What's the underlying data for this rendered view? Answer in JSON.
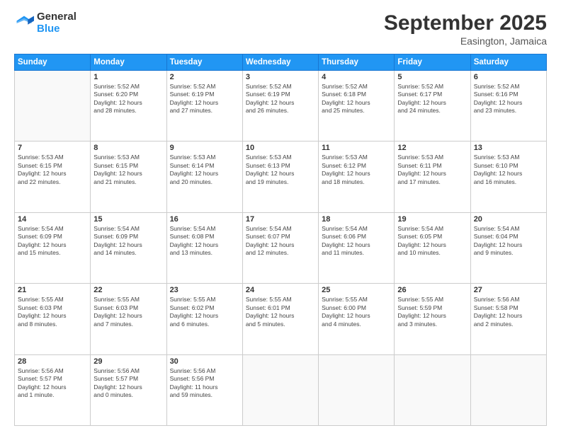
{
  "logo": {
    "general": "General",
    "blue": "Blue"
  },
  "header": {
    "month": "September 2025",
    "location": "Easington, Jamaica"
  },
  "weekdays": [
    "Sunday",
    "Monday",
    "Tuesday",
    "Wednesday",
    "Thursday",
    "Friday",
    "Saturday"
  ],
  "weeks": [
    [
      {
        "day": "",
        "info": ""
      },
      {
        "day": "1",
        "info": "Sunrise: 5:52 AM\nSunset: 6:20 PM\nDaylight: 12 hours\nand 28 minutes."
      },
      {
        "day": "2",
        "info": "Sunrise: 5:52 AM\nSunset: 6:19 PM\nDaylight: 12 hours\nand 27 minutes."
      },
      {
        "day": "3",
        "info": "Sunrise: 5:52 AM\nSunset: 6:19 PM\nDaylight: 12 hours\nand 26 minutes."
      },
      {
        "day": "4",
        "info": "Sunrise: 5:52 AM\nSunset: 6:18 PM\nDaylight: 12 hours\nand 25 minutes."
      },
      {
        "day": "5",
        "info": "Sunrise: 5:52 AM\nSunset: 6:17 PM\nDaylight: 12 hours\nand 24 minutes."
      },
      {
        "day": "6",
        "info": "Sunrise: 5:52 AM\nSunset: 6:16 PM\nDaylight: 12 hours\nand 23 minutes."
      }
    ],
    [
      {
        "day": "7",
        "info": "Sunrise: 5:53 AM\nSunset: 6:15 PM\nDaylight: 12 hours\nand 22 minutes."
      },
      {
        "day": "8",
        "info": "Sunrise: 5:53 AM\nSunset: 6:15 PM\nDaylight: 12 hours\nand 21 minutes."
      },
      {
        "day": "9",
        "info": "Sunrise: 5:53 AM\nSunset: 6:14 PM\nDaylight: 12 hours\nand 20 minutes."
      },
      {
        "day": "10",
        "info": "Sunrise: 5:53 AM\nSunset: 6:13 PM\nDaylight: 12 hours\nand 19 minutes."
      },
      {
        "day": "11",
        "info": "Sunrise: 5:53 AM\nSunset: 6:12 PM\nDaylight: 12 hours\nand 18 minutes."
      },
      {
        "day": "12",
        "info": "Sunrise: 5:53 AM\nSunset: 6:11 PM\nDaylight: 12 hours\nand 17 minutes."
      },
      {
        "day": "13",
        "info": "Sunrise: 5:53 AM\nSunset: 6:10 PM\nDaylight: 12 hours\nand 16 minutes."
      }
    ],
    [
      {
        "day": "14",
        "info": "Sunrise: 5:54 AM\nSunset: 6:09 PM\nDaylight: 12 hours\nand 15 minutes."
      },
      {
        "day": "15",
        "info": "Sunrise: 5:54 AM\nSunset: 6:09 PM\nDaylight: 12 hours\nand 14 minutes."
      },
      {
        "day": "16",
        "info": "Sunrise: 5:54 AM\nSunset: 6:08 PM\nDaylight: 12 hours\nand 13 minutes."
      },
      {
        "day": "17",
        "info": "Sunrise: 5:54 AM\nSunset: 6:07 PM\nDaylight: 12 hours\nand 12 minutes."
      },
      {
        "day": "18",
        "info": "Sunrise: 5:54 AM\nSunset: 6:06 PM\nDaylight: 12 hours\nand 11 minutes."
      },
      {
        "day": "19",
        "info": "Sunrise: 5:54 AM\nSunset: 6:05 PM\nDaylight: 12 hours\nand 10 minutes."
      },
      {
        "day": "20",
        "info": "Sunrise: 5:54 AM\nSunset: 6:04 PM\nDaylight: 12 hours\nand 9 minutes."
      }
    ],
    [
      {
        "day": "21",
        "info": "Sunrise: 5:55 AM\nSunset: 6:03 PM\nDaylight: 12 hours\nand 8 minutes."
      },
      {
        "day": "22",
        "info": "Sunrise: 5:55 AM\nSunset: 6:03 PM\nDaylight: 12 hours\nand 7 minutes."
      },
      {
        "day": "23",
        "info": "Sunrise: 5:55 AM\nSunset: 6:02 PM\nDaylight: 12 hours\nand 6 minutes."
      },
      {
        "day": "24",
        "info": "Sunrise: 5:55 AM\nSunset: 6:01 PM\nDaylight: 12 hours\nand 5 minutes."
      },
      {
        "day": "25",
        "info": "Sunrise: 5:55 AM\nSunset: 6:00 PM\nDaylight: 12 hours\nand 4 minutes."
      },
      {
        "day": "26",
        "info": "Sunrise: 5:55 AM\nSunset: 5:59 PM\nDaylight: 12 hours\nand 3 minutes."
      },
      {
        "day": "27",
        "info": "Sunrise: 5:56 AM\nSunset: 5:58 PM\nDaylight: 12 hours\nand 2 minutes."
      }
    ],
    [
      {
        "day": "28",
        "info": "Sunrise: 5:56 AM\nSunset: 5:57 PM\nDaylight: 12 hours\nand 1 minute."
      },
      {
        "day": "29",
        "info": "Sunrise: 5:56 AM\nSunset: 5:57 PM\nDaylight: 12 hours\nand 0 minutes."
      },
      {
        "day": "30",
        "info": "Sunrise: 5:56 AM\nSunset: 5:56 PM\nDaylight: 11 hours\nand 59 minutes."
      },
      {
        "day": "",
        "info": ""
      },
      {
        "day": "",
        "info": ""
      },
      {
        "day": "",
        "info": ""
      },
      {
        "day": "",
        "info": ""
      }
    ]
  ]
}
